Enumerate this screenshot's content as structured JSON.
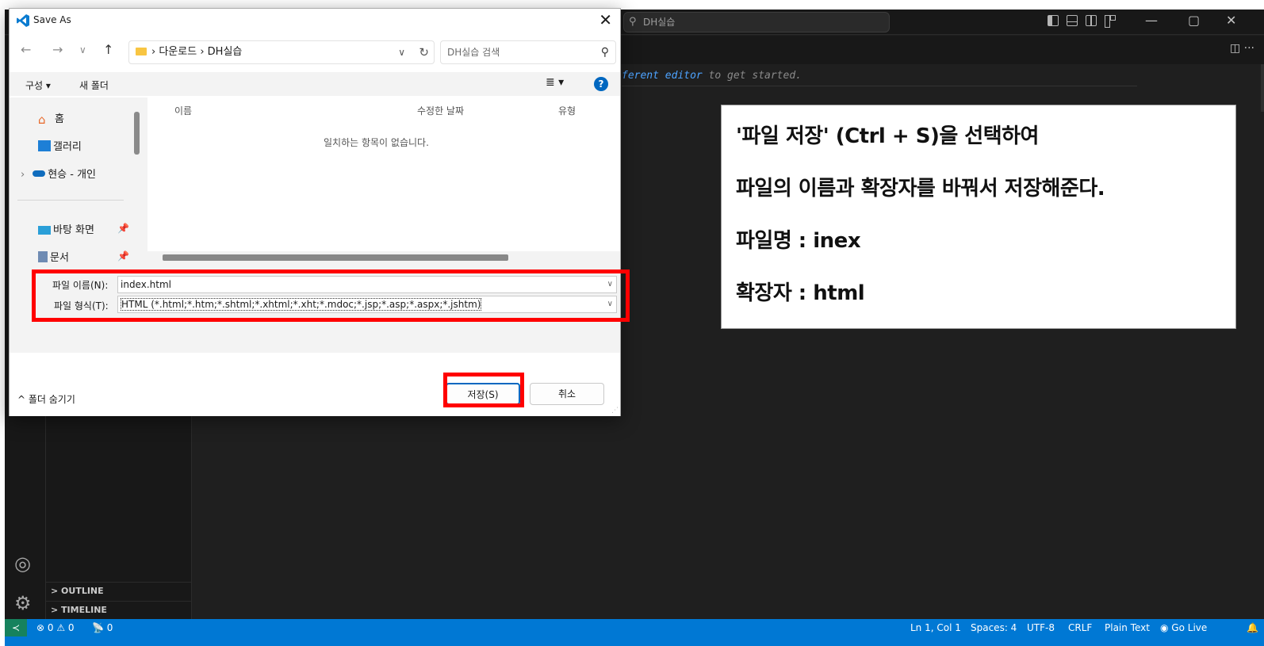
{
  "vscode": {
    "command_center": "DH실습",
    "editor_hint_pre": "ferent editor",
    "editor_hint_post": " to get started.",
    "sidebar_sections": [
      "OUTLINE",
      "TIMELINE"
    ],
    "status": {
      "problems": "⊗ 0 ⚠ 0",
      "ports": "0",
      "position": "Ln 1, Col 1",
      "spaces": "Spaces: 4",
      "encoding": "UTF-8",
      "eol": "CRLF",
      "language": "Plain Text",
      "golive": "Go Live"
    }
  },
  "dialog": {
    "title": "Save As",
    "path": [
      "다운로드",
      "DH실습"
    ],
    "search_placeholder": "DH실습 검색",
    "toolbar": {
      "organize": "구성 ▾",
      "new_folder": "새 폴더"
    },
    "nav": {
      "home": "홈",
      "gallery": "갤러리",
      "onedrive": "현승 - 개인",
      "desktop": "바탕 화면",
      "documents": "문서"
    },
    "columns": [
      "이름",
      "수정한 날짜",
      "유형"
    ],
    "empty_text": "일치하는 항목이 없습니다.",
    "filename_label": "파일 이름(N):",
    "filename_value": "index.html",
    "filetype_label": "파일 형식(T):",
    "filetype_value": "HTML (*.html;*.htm;*.shtml;*.xhtml;*.xht;*.mdoc;*.jsp;*.asp;*.aspx;*.jshtm)",
    "hide_folders": "폴더 숨기기",
    "save": "저장(S)",
    "cancel": "취소"
  },
  "annotation": {
    "lines": [
      "'파일 저장' (Ctrl + S)을 선택하여",
      "파일의 이름과 확장자를 바꿔서 저장해준다.",
      "파일명 : inex",
      "확장자 : html"
    ]
  },
  "colors": {
    "highlight": "#ff0000",
    "statusbar": "#0078d4",
    "accent": "#0067c0"
  }
}
